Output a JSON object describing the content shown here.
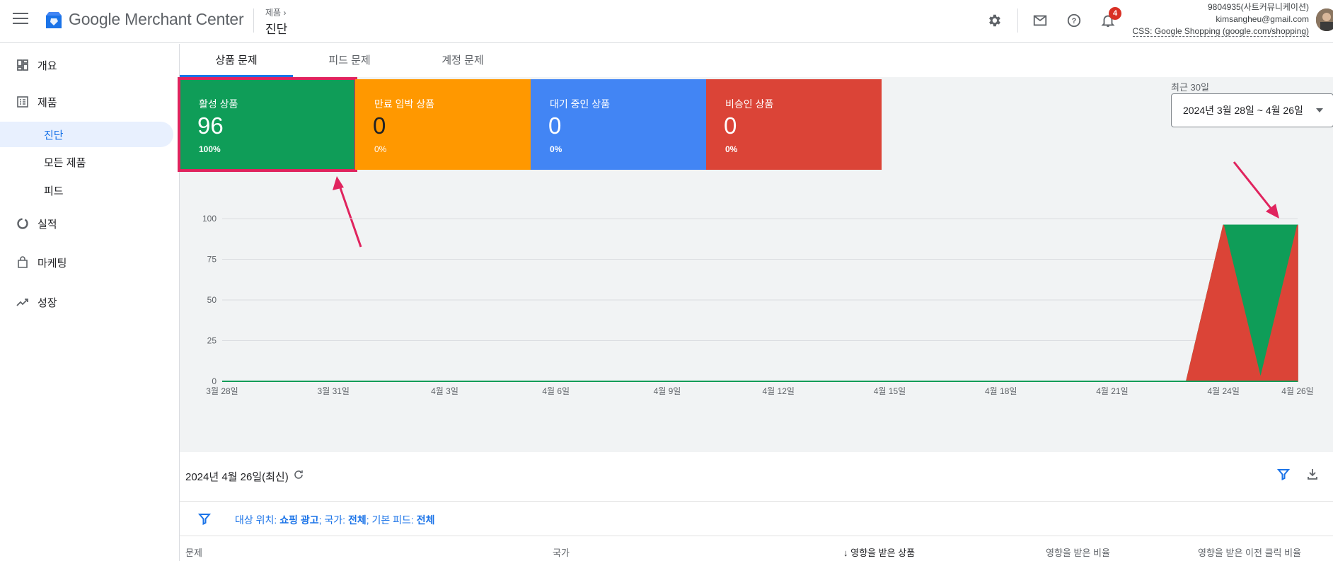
{
  "header": {
    "app_name": "Google Merchant Center",
    "breadcrumb": "제품",
    "page_title": "진단",
    "notification_count": "4",
    "account_name": "9804935(사트커뮤니케이션)",
    "account_email": "kimsangheu@gmail.com",
    "css_label": "CSS: Google Shopping (google.com/shopping)"
  },
  "sidebar": {
    "items": [
      {
        "label": "개요",
        "icon": "dashboard-icon"
      },
      {
        "label": "제품",
        "icon": "list-icon"
      },
      {
        "label": "진단",
        "sub": true,
        "active": true
      },
      {
        "label": "모든 제품",
        "sub": true
      },
      {
        "label": "피드",
        "sub": true
      },
      {
        "label": "실적",
        "icon": "donut-icon"
      },
      {
        "label": "마케팅",
        "icon": "shopping-bag-icon"
      },
      {
        "label": "성장",
        "icon": "trending-up-icon"
      }
    ]
  },
  "tabs": [
    {
      "label": "상품 문제",
      "active": true
    },
    {
      "label": "피드 문제"
    },
    {
      "label": "계정 문제"
    }
  ],
  "cards": [
    {
      "label": "활성 상품",
      "value": "96",
      "percent": "100%",
      "color": "#0f9d58"
    },
    {
      "label": "만료 임박 상품",
      "value": "0",
      "percent": "0%",
      "color": "#ff9800"
    },
    {
      "label": "대기 중인 상품",
      "value": "0",
      "percent": "0%",
      "color": "#4285f4"
    },
    {
      "label": "비승인 상품",
      "value": "0",
      "percent": "0%",
      "color": "#db4437"
    }
  ],
  "date_range": {
    "label": "최근 30일",
    "value": "2024년 3월 28일 ~ 4월 26일"
  },
  "chart_data": {
    "type": "area",
    "x": [
      "3월 28일",
      "3월 29일",
      "3월 30일",
      "3월 31일",
      "4월 1일",
      "4월 2일",
      "4월 3일",
      "4월 4일",
      "4월 5일",
      "4월 6일",
      "4월 7일",
      "4월 8일",
      "4월 9일",
      "4월 10일",
      "4월 11일",
      "4월 12일",
      "4월 13일",
      "4월 14일",
      "4월 15일",
      "4월 16일",
      "4월 17일",
      "4월 18일",
      "4월 19일",
      "4월 20일",
      "4월 21일",
      "4월 22일",
      "4월 23일",
      "4월 24일",
      "4월 25일",
      "4월 26일"
    ],
    "xticks": [
      "3월 28일",
      "3월 31일",
      "4월 3일",
      "4월 6일",
      "4월 9일",
      "4월 12일",
      "4월 15일",
      "4월 18일",
      "4월 21일",
      "4월 24일",
      "4월 26일"
    ],
    "yticks": [
      0,
      25,
      50,
      75,
      100
    ],
    "ylim": [
      0,
      100
    ],
    "series": [
      {
        "name": "활성 상품",
        "color": "#0f9d58",
        "values": [
          0,
          0,
          0,
          0,
          0,
          0,
          0,
          0,
          0,
          0,
          0,
          0,
          0,
          0,
          0,
          0,
          0,
          0,
          0,
          0,
          0,
          0,
          0,
          0,
          0,
          0,
          0,
          96,
          96,
          96
        ]
      },
      {
        "name": "비승인 상품",
        "color": "#db4437",
        "values": [
          0,
          0,
          0,
          0,
          0,
          0,
          0,
          0,
          0,
          0,
          0,
          0,
          0,
          0,
          0,
          0,
          0,
          0,
          0,
          0,
          0,
          0,
          0,
          0,
          0,
          0,
          0,
          96,
          2,
          96
        ]
      }
    ]
  },
  "results": {
    "date_text": "2024년 4월 26일(최신)"
  },
  "filter": {
    "prefix1": "대상 위치: ",
    "value1": "쇼핑 광고",
    "prefix2": "; 국가: ",
    "value2": "전체",
    "prefix3": "; 기본 피드: ",
    "value3": "전체"
  },
  "table": {
    "columns": [
      "문제",
      "국가",
      "영향을 받은 상품",
      "영향을 받은 비율",
      "영향을 받은 이전 클릭 비율"
    ]
  }
}
